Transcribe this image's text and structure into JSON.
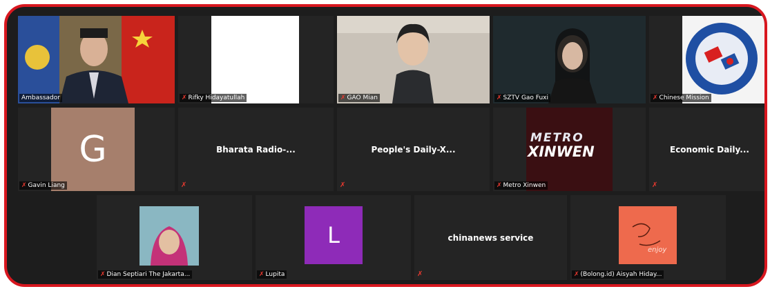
{
  "meeting": {
    "row1": [
      {
        "name": "Ambassador",
        "speaking": true
      },
      {
        "name": "Rifky Hidayatullah"
      },
      {
        "name": "GAO Mian"
      },
      {
        "name": "SZTV Gao Fuxi"
      },
      {
        "name": "Chinese Mission"
      }
    ],
    "row2": [
      {
        "name": "Gavin Liang",
        "avatar_letter": "G",
        "avatar_color": "#a67f6c"
      },
      {
        "title": "Bharata Radio-..."
      },
      {
        "title": "People's Daily-X..."
      },
      {
        "name": "Metro Xinwen",
        "logo_line1": "METRO",
        "logo_line2": "XINWEN"
      },
      {
        "title": "Economic Daily..."
      }
    ],
    "row3": [
      {
        "name": "Dian Septiari The Jakarta..."
      },
      {
        "name": "Lupita",
        "avatar_letter": "L",
        "avatar_color": "#8e2bb8"
      },
      {
        "title": "chinanews service"
      },
      {
        "name": "(Bolong.id) Aisyah Hiday...",
        "logo_text": "enjoy",
        "avatar_color": "#ee6a4d"
      }
    ]
  },
  "colors": {
    "frame_border": "#d8171f",
    "active_speaker": "#b5e61d",
    "mic_muted": "#e8392f"
  }
}
